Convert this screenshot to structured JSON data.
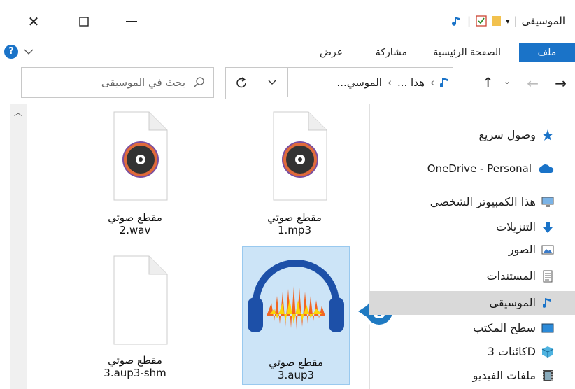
{
  "window": {
    "title": "الموسيقى",
    "controls": {
      "close": "✕",
      "maximize": "☐",
      "minimize": "—"
    }
  },
  "ribbon": {
    "tabs": [
      "ملف",
      "الصفحة الرئيسية",
      "مشاركة",
      "عرض"
    ],
    "active_tab": "ملف",
    "help": "?"
  },
  "address_bar": {
    "path_first": "هذا ...",
    "path_second": "الموسي...",
    "search_placeholder": "بحث في الموسيقى"
  },
  "sidebar": {
    "items": [
      {
        "label": "وصول سريع",
        "icon": "star-icon"
      },
      {
        "label": "OneDrive - Personal",
        "icon": "cloud-icon"
      },
      {
        "label": "هذا الكمبيوتر الشخصي",
        "icon": "computer-icon"
      },
      {
        "label": "التنزيلات",
        "icon": "download-icon"
      },
      {
        "label": "الصور",
        "icon": "pictures-icon"
      },
      {
        "label": "المستندات",
        "icon": "documents-icon"
      },
      {
        "label": "الموسيقى",
        "icon": "music-icon",
        "selected": true
      },
      {
        "label": "سطح المكتب",
        "icon": "desktop-icon"
      },
      {
        "label": "كائنات 3D",
        "icon": "cube-icon"
      },
      {
        "label": "ملفات الفيديو",
        "icon": "video-icon"
      }
    ]
  },
  "files": [
    {
      "line1": "مقطع صوتي",
      "line2": "1.mp3",
      "icon": "audio-file-icon"
    },
    {
      "line1": "مقطع صوتي",
      "line2": "2.wav",
      "icon": "audio-file-icon"
    },
    {
      "line1": "مقطع صوتي",
      "line2": "3.aup3",
      "icon": "audacity-icon",
      "selected": true
    },
    {
      "line1": "مقطع صوتي",
      "line2": "3.aup3-shm",
      "icon": "blank-file-icon"
    }
  ],
  "callout": {
    "number": "8"
  },
  "colors": {
    "accent": "#1a73c8",
    "selected_nav": "#d9d9d9",
    "selected_file": "#cce4f7",
    "callout": "#1f7ac2"
  }
}
